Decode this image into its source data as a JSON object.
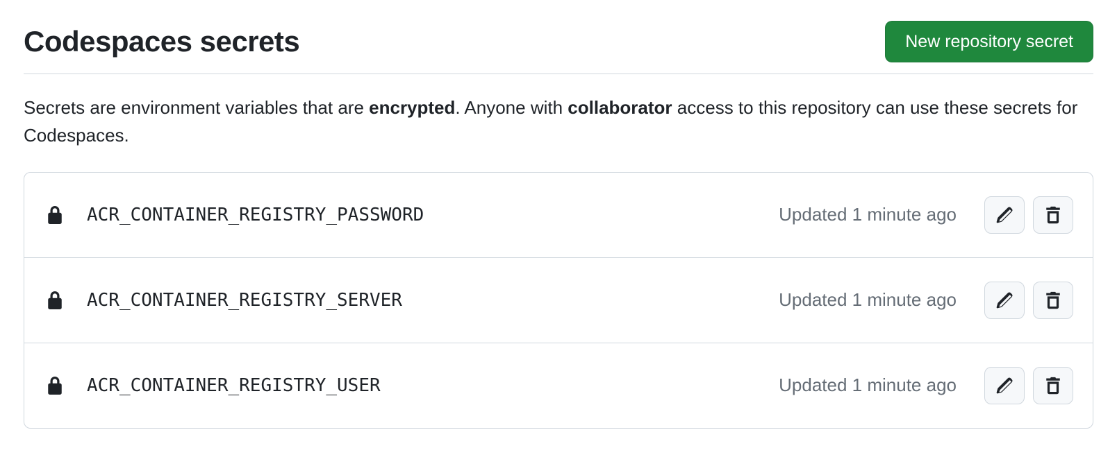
{
  "header": {
    "title": "Codespaces secrets",
    "new_button": "New repository secret"
  },
  "description": {
    "part1": "Secrets are environment variables that are ",
    "bold1": "encrypted",
    "part2": ". Anyone with ",
    "bold2": "collaborator",
    "part3": " access to this repository can use these secrets for Codespaces."
  },
  "secrets": [
    {
      "name": "ACR_CONTAINER_REGISTRY_PASSWORD",
      "updated": "Updated 1 minute ago"
    },
    {
      "name": "ACR_CONTAINER_REGISTRY_SERVER",
      "updated": "Updated 1 minute ago"
    },
    {
      "name": "ACR_CONTAINER_REGISTRY_USER",
      "updated": "Updated 1 minute ago"
    }
  ]
}
